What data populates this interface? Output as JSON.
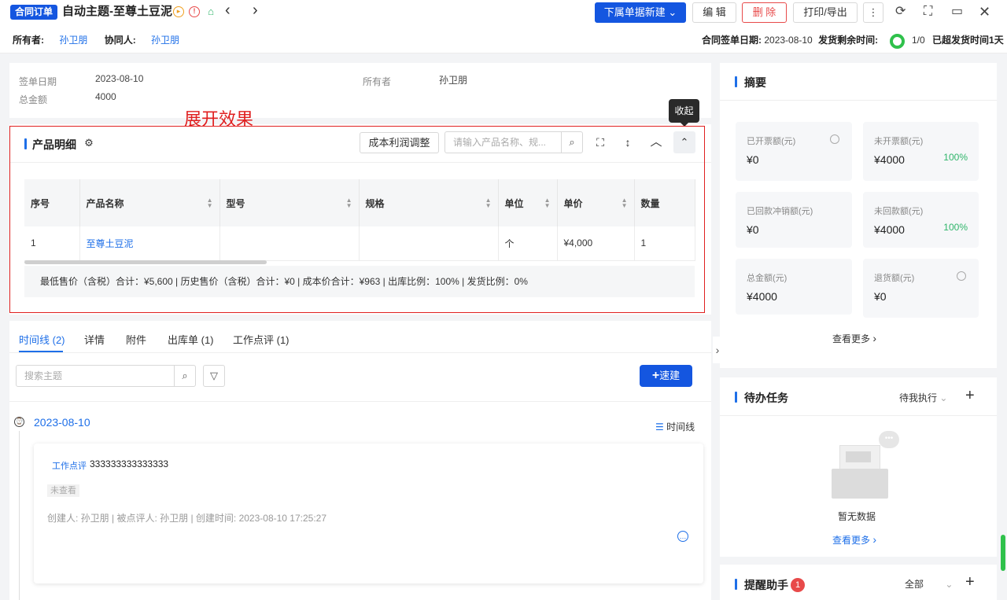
{
  "header": {
    "tag": "合同订单",
    "title": "自动主题-至尊土豆泥",
    "buttons": {
      "new_sub": "下属单据新建",
      "edit": "编 辑",
      "delete": "删 除",
      "print": "打印/导出"
    },
    "owner_label": "所有者:",
    "owner": "孙卫朋",
    "collab_label": "协同人:",
    "collab": "孙卫朋",
    "sign_date_label": "合同签单日期:",
    "sign_date": "2023-08-10",
    "remaining_label": "发货剩余时间:",
    "count": "1/0",
    "overdue": "已超发货时间1天"
  },
  "info": {
    "sign_date_label": "签单日期",
    "sign_date": "2023-08-10",
    "total_label": "总金额",
    "total": "4000",
    "owner_label": "所有者",
    "owner": "孙卫朋"
  },
  "annotation": "展开效果",
  "product": {
    "title": "产品明细",
    "adjust_button": "成本利润调整",
    "search_placeholder": "请输入产品名称、规...",
    "tooltip": "收起",
    "columns": [
      "序号",
      "产品名称",
      "型号",
      "规格",
      "单位",
      "单价",
      "数量"
    ],
    "rows": [
      [
        "1",
        "至尊土豆泥",
        "",
        "",
        "个",
        "¥4,000",
        "1"
      ]
    ],
    "summary": "最低售价（含税）合计：¥5,600 |   历史售价（含税）合计：¥0 |   成本价合计：¥963 |   出库比例：100% |   发货比例：0%"
  },
  "tabs": [
    "时间线 (2)",
    "详情",
    "附件",
    "出库单 (1)",
    "工作点评 (1)"
  ],
  "timeline": {
    "search_placeholder": "搜索主题",
    "quick_button": "速建",
    "date": "2023-08-10",
    "view_label": "时间线",
    "entry": {
      "type": "工作点评",
      "content": "333333333333333",
      "status": "未查看",
      "meta": "创建人: 孙卫朋  |  被点评人: 孙卫朋  |  创建时间: 2023-08-10 17:25:27"
    }
  },
  "summary_panel": {
    "title": "摘要",
    "cards": [
      {
        "label": "已开票额(元)",
        "value": "¥0",
        "pct": ""
      },
      {
        "label": "未开票额(元)",
        "value": "¥4000",
        "pct": "100%"
      },
      {
        "label": "已回款冲销额(元)",
        "value": "¥0",
        "pct": ""
      },
      {
        "label": "未回款额(元)",
        "value": "¥4000",
        "pct": "100%"
      },
      {
        "label": "总金额(元)",
        "value": "¥4000",
        "pct": ""
      },
      {
        "label": "退货额(元)",
        "value": "¥0",
        "pct": ""
      }
    ],
    "more": "查看更多"
  },
  "todo": {
    "title": "待办任务",
    "filter": "待我执行",
    "empty": "暂无数据",
    "more": "查看更多"
  },
  "reminder": {
    "title": "提醒助手",
    "badge": "1",
    "filter": "全部"
  },
  "colors": {
    "primary": "#1456e0",
    "link": "#1e6fe8",
    "danger": "#e84a4a",
    "success": "#2fc14b"
  }
}
